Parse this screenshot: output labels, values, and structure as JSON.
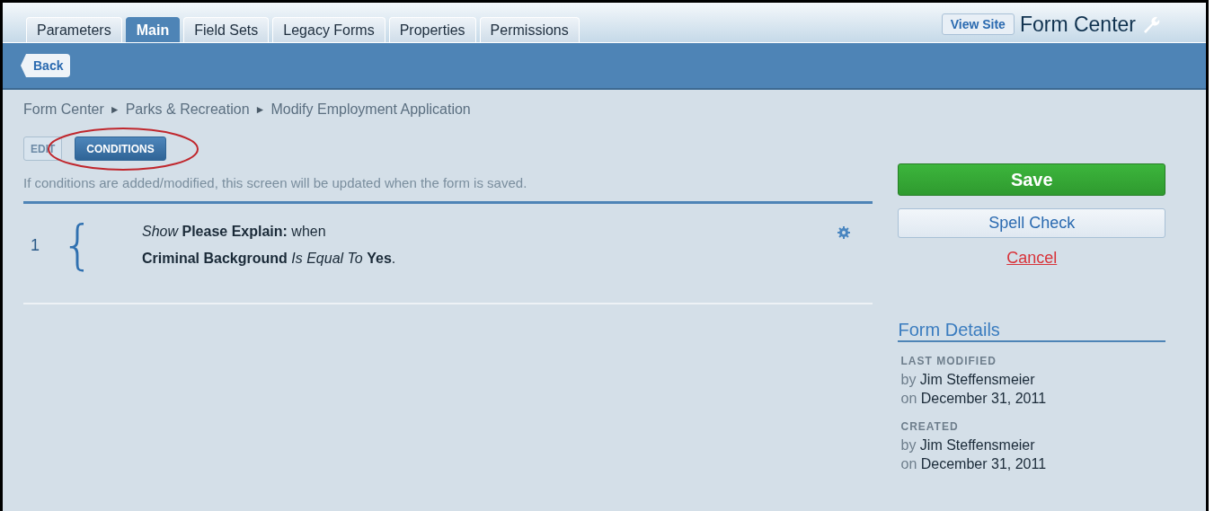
{
  "tabs": [
    {
      "label": "Parameters",
      "selected": false
    },
    {
      "label": "Main",
      "selected": true
    },
    {
      "label": "Field Sets",
      "selected": false
    },
    {
      "label": "Legacy Forms",
      "selected": false
    },
    {
      "label": "Properties",
      "selected": false
    },
    {
      "label": "Permissions",
      "selected": false
    }
  ],
  "view_site_button": "View Site",
  "app_title": "Form Center",
  "back_button": "Back",
  "breadcrumb": [
    "Form Center",
    "Parks & Recreation",
    "Modify Employment Application"
  ],
  "breadcrumb_separator": "►",
  "mode_buttons": [
    {
      "label": "EDIT",
      "selected": false
    },
    {
      "label": "CONDITIONS",
      "selected": true
    }
  ],
  "annotation": {
    "kind": "ellipse"
  },
  "notice": "If conditions are added/modified, this screen will be updated when the form is saved.",
  "conditions": [
    {
      "number": "1",
      "brace": "{",
      "lines": [
        "*Show* **Please Explain:** when",
        "**Criminal Background** *Is Equal To* **Yes**."
      ]
    }
  ],
  "actions": {
    "save": "Save",
    "spell_check": "Spell Check",
    "cancel": "Cancel"
  },
  "form_details": {
    "title": "Form Details",
    "entries": [
      {
        "heading": "LAST MODIFIED",
        "by_prefix": "by",
        "by": "Jim Steffensmeier",
        "on_prefix": "on",
        "on": "December 31, 2011"
      },
      {
        "heading": "CREATED",
        "by_prefix": "by",
        "by": "Jim Steffensmeier",
        "on_prefix": "on",
        "on": "December 31, 2011"
      }
    ]
  }
}
